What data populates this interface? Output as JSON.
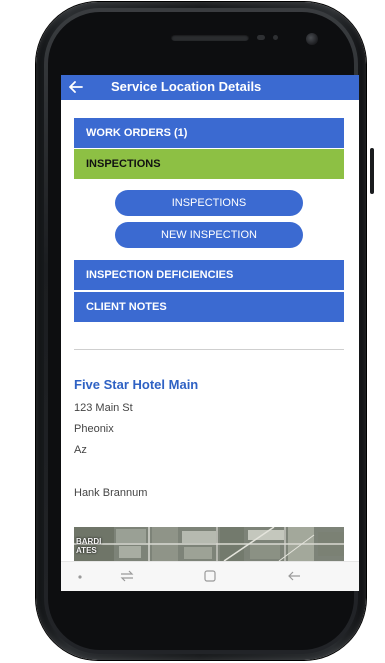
{
  "app_bar": {
    "title": "Service Location Details",
    "back_icon": "arrow-left-icon",
    "color": "#3b6ad1"
  },
  "menu": {
    "work_orders": "WORK ORDERS (1)",
    "inspections": "INSPECTIONS",
    "inspection_deficiencies": "INSPECTION DEFICIENCIES",
    "client_notes": "CLIENT NOTES",
    "selected_color": "#8dc044"
  },
  "inspection_actions": {
    "inspections_button": "INSPECTIONS",
    "new_inspection_button": "NEW INSPECTION"
  },
  "location": {
    "name": "Five Star Hotel Main",
    "street": "123 Main St",
    "city": "Pheonix",
    "state": "Az",
    "contact": "Hank Brannum"
  },
  "map": {
    "label_line1": "BARDI",
    "label_line2": "ATES"
  },
  "system_nav": {
    "icons": [
      "dot-icon",
      "recent-apps-icon",
      "home-icon",
      "back-arrow-icon"
    ]
  }
}
